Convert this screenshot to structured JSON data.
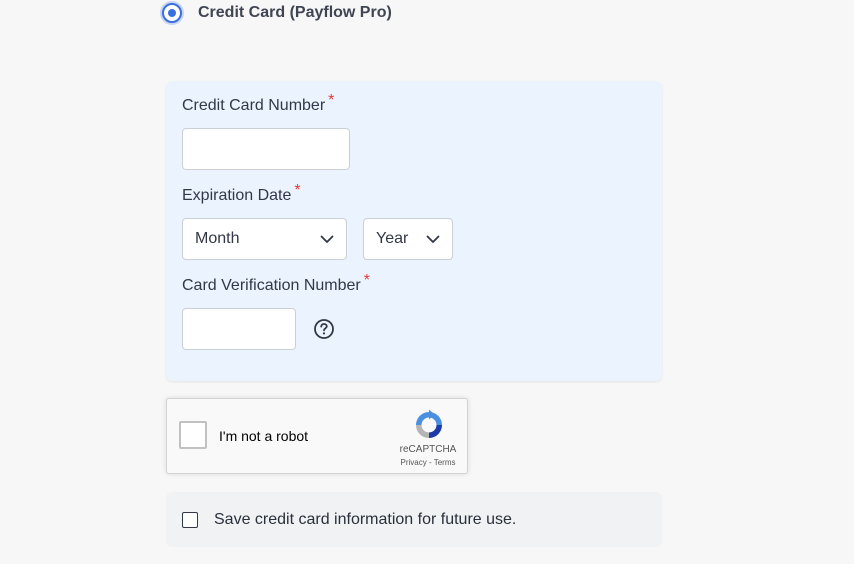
{
  "payment_method": {
    "label": "Credit Card (Payflow Pro)",
    "selected": true,
    "accent_color": "#3b6fe0"
  },
  "card_form": {
    "card_number": {
      "label": "Credit Card Number",
      "required_mark": "*",
      "value": "",
      "placeholder": ""
    },
    "expiration": {
      "label": "Expiration Date",
      "required_mark": "*",
      "month": {
        "selected": "Month",
        "icon": "chevron-down-icon"
      },
      "year": {
        "selected": "Year",
        "icon": "chevron-down-icon"
      }
    },
    "cvv": {
      "label": "Card Verification Number",
      "required_mark": "*",
      "value": "",
      "placeholder": "",
      "help_icon": "question-circle-icon"
    },
    "background_color": "#ebf4fe",
    "required_color": "#e23a3a"
  },
  "recaptcha": {
    "checkbox_label": "I'm not a robot",
    "brand": "reCAPTCHA",
    "privacy_link": "Privacy",
    "separator": "-",
    "terms_link": "Terms",
    "checked": false
  },
  "save_card": {
    "label": "Save credit card information for future use.",
    "checked": false
  }
}
